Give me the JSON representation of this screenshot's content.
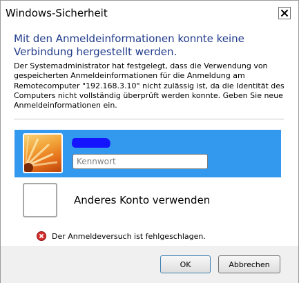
{
  "window": {
    "title": "Windows-Sicherheit",
    "close_icon": "close-icon"
  },
  "message": {
    "heading": "Mit den Anmeldeinformationen konnte keine Verbindung hergestellt werden.",
    "description": "Der Systemadministrator hat festgelegt, dass die Verwendung von gespeicherten Anmeldeinformationen für die Anmeldung am Remotecomputer \"192.168.3.10\" nicht zulässig ist, da die Identität des Computers nicht vollständig überprüft werden konnte. Geben Sie neue Anmeldeinformationen ein."
  },
  "accounts": {
    "selected": {
      "username": "",
      "password_placeholder": "Kennwort",
      "password_value": "",
      "avatar_icon": "flower-avatar-icon"
    },
    "other": {
      "label": "Anderes Konto verwenden",
      "avatar_icon": "empty-avatar-icon"
    }
  },
  "error": {
    "icon": "error-icon",
    "text": "Der Anmeldeversuch ist fehlgeschlagen."
  },
  "buttons": {
    "ok_label": "OK",
    "cancel_label": "Abbrechen"
  },
  "colors": {
    "selection": "#3399ee",
    "heading": "#1f3a8a",
    "error": "#d42b2b"
  }
}
